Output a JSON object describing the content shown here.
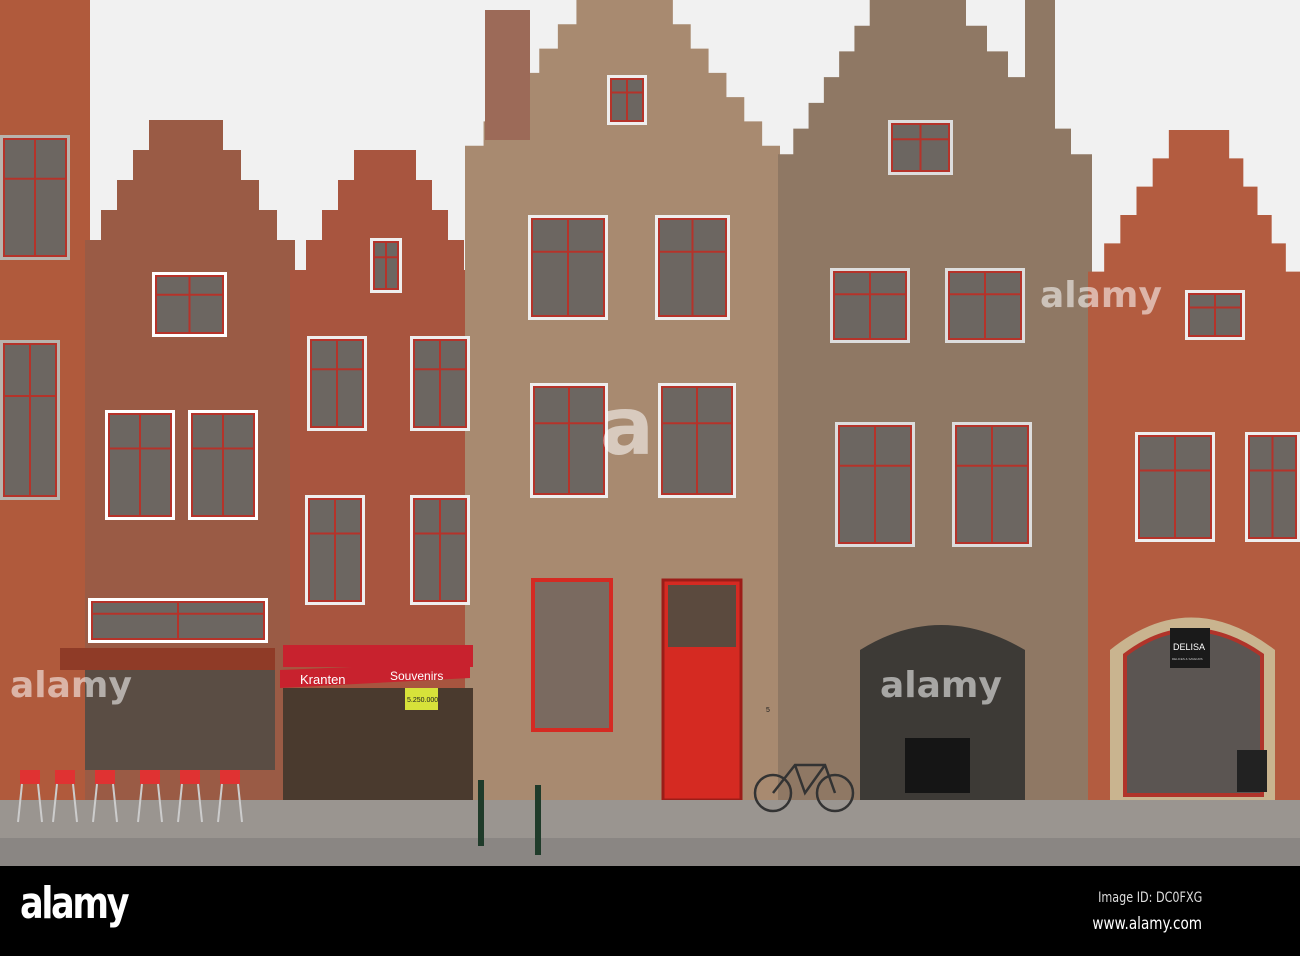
{
  "photo": {
    "awning_left_text": "Kranten",
    "awning_right_text": "Souvenirs",
    "lottery_sign": "5.250.000",
    "shop_sign": "DELISA",
    "shop_sign_sub": "DELICES & SAVEURS",
    "house_number": "5"
  },
  "watermark": {
    "center": "a",
    "side": "alamy"
  },
  "footer": {
    "logo": "alamy",
    "image_id": "Image ID: DC0FXG",
    "url": "www.alamy.com"
  },
  "colors": {
    "sky": "#f1f1f1",
    "red_brick": "#a8553f",
    "tan_brick": "#a88a70",
    "door_red": "#d52a22",
    "awning_red": "#c8222e"
  }
}
